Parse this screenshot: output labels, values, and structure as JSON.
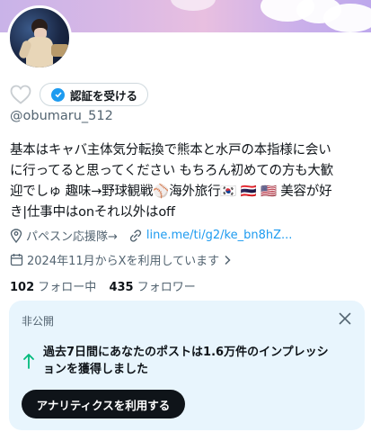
{
  "profile": {
    "verify_button_label": "認証を受ける",
    "handle": "@obumaru_512",
    "bio_lines": [
      "基本はキャバ主体気分転換で熊本と水戸の本指様に会い",
      "に行ってると思ってください もちろん初めての方も大歓",
      "迎でしゅ 趣味→野球観戦⚾海外旅行🇰🇷 🇹🇭 🇺🇸 美容が好",
      "き|仕事中はonそれ以外はoff"
    ],
    "location": "パペスン応援隊→",
    "link": "line.me/ti/g2/ke_bn8hZ...",
    "joined": "2024年11月からXを利用しています",
    "following_count": "102",
    "following_label": "フォロー中",
    "followers_count": "435",
    "followers_label": "フォロワー"
  },
  "insight_card": {
    "private_label": "非公開",
    "message_line1": "過去7日間にあなたのポストは1.6万件のインプレッシ",
    "message_line2": "ョンを獲得しました",
    "button_label": "アナリティクスを利用する"
  },
  "colors": {
    "accent": "#1d9bf0",
    "card_bg": "#e8f5fd",
    "secondary_text": "#536471",
    "arrow_green": "#00ba7c"
  },
  "icons": [
    "heart-outline-icon",
    "verified-check-icon",
    "location-pin-icon",
    "link-icon",
    "calendar-icon",
    "chevron-right-icon",
    "close-icon",
    "arrow-up-icon"
  ]
}
